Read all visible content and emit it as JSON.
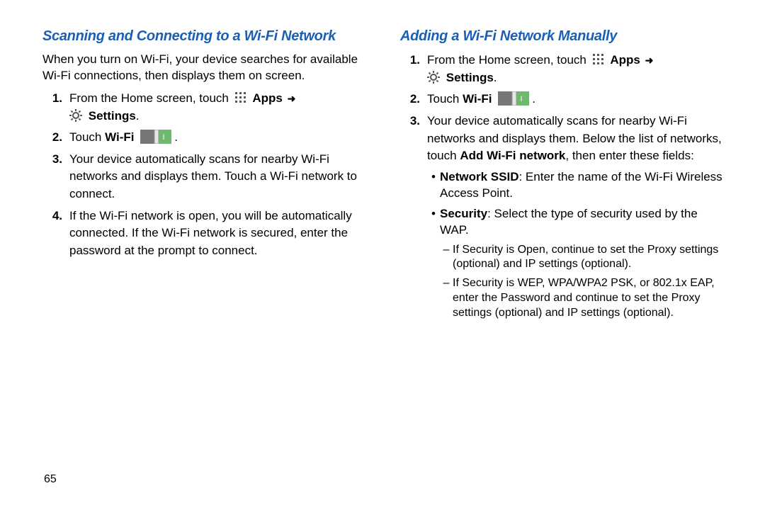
{
  "page_number": "65",
  "left": {
    "heading": "Scanning and Connecting to a Wi-Fi Network",
    "intro": "When you turn on Wi-Fi, your device searches for available Wi-Fi connections, then displays them on screen.",
    "step1_a": "From the Home screen, touch ",
    "apps_label": "Apps",
    "settings_label": "Settings",
    "step1_period": ".",
    "step2_a": "Touch ",
    "wifi_label": "Wi-Fi",
    "step2_period": ".",
    "step3": "Your device automatically scans for nearby Wi-Fi networks and displays them. Touch a Wi-Fi network to connect.",
    "step4": "If the Wi-Fi network is open, you will be automatically connected. If the Wi-Fi network is secured, enter the password at the prompt to connect."
  },
  "right": {
    "heading": "Adding a Wi-Fi Network Manually",
    "step1_a": "From the Home screen, touch ",
    "apps_label": "Apps",
    "settings_label": "Settings",
    "step1_period": ".",
    "step2_a": "Touch ",
    "wifi_label": "Wi-Fi",
    "step2_period": ".",
    "step3_a": "Your device automatically scans for nearby Wi-Fi networks and displays them. Below the list of networks, touch ",
    "add_wifi_label": "Add Wi-Fi network",
    "step3_b": ", then enter these fields:",
    "bullet1_label": "Network SSID",
    "bullet1_text": ": Enter the name of the Wi-Fi Wireless Access Point.",
    "bullet2_label": "Security",
    "bullet2_text": ": Select the type of security used by the WAP.",
    "dash1": "If Security is Open, continue to set the Proxy settings (optional) and IP settings (optional).",
    "dash2": "If Security is WEP, WPA/WPA2 PSK, or 802.1x EAP, enter the Password and continue to set the Proxy settings (optional) and IP settings (optional)."
  },
  "nums": {
    "n1": "1.",
    "n2": "2.",
    "n3": "3.",
    "n4": "4."
  },
  "marks": {
    "bullet": "•",
    "dash": "–"
  },
  "toggle_text": "I"
}
